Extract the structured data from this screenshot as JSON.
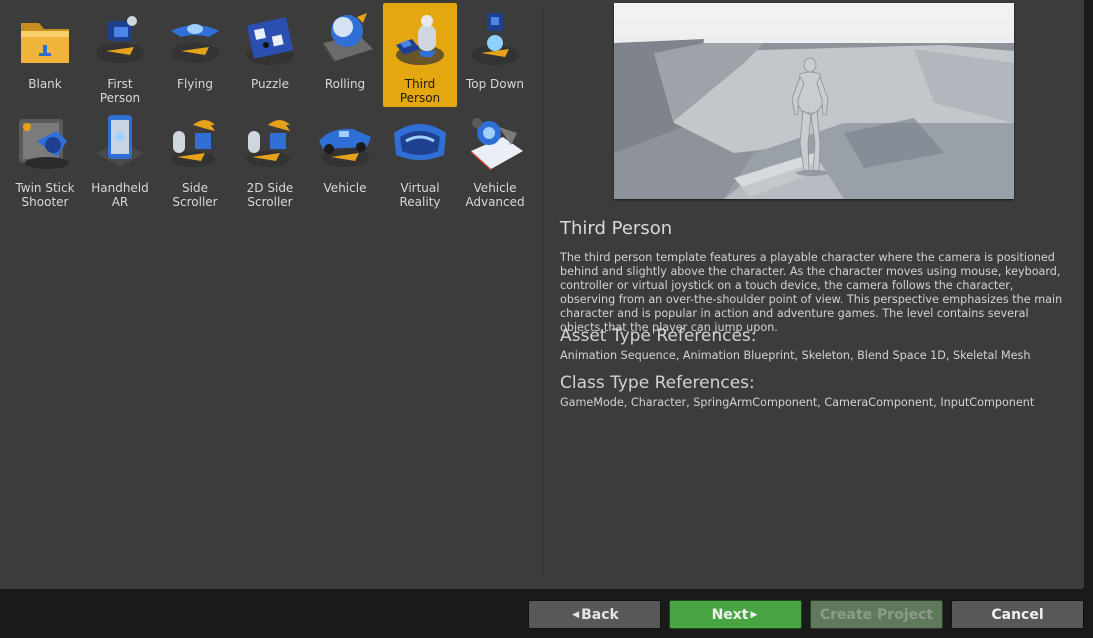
{
  "templates": [
    {
      "line1": "Blank",
      "line2": "",
      "icon": "folder-icon",
      "selected": false
    },
    {
      "line1": "First",
      "line2": "Person",
      "icon": "first-person-icon",
      "selected": false
    },
    {
      "line1": "Flying",
      "line2": "",
      "icon": "flying-icon",
      "selected": false
    },
    {
      "line1": "Puzzle",
      "line2": "",
      "icon": "puzzle-icon",
      "selected": false
    },
    {
      "line1": "Rolling",
      "line2": "",
      "icon": "rolling-icon",
      "selected": false
    },
    {
      "line1": "Third",
      "line2": "Person",
      "icon": "third-person-icon",
      "selected": true
    },
    {
      "line1": "Top Down",
      "line2": "",
      "icon": "top-down-icon",
      "selected": false
    },
    {
      "line1": "Twin Stick",
      "line2": "Shooter",
      "icon": "twin-stick-icon",
      "selected": false
    },
    {
      "line1": "Handheld",
      "line2": "AR",
      "icon": "handheld-ar-icon",
      "selected": false
    },
    {
      "line1": "Side",
      "line2": "Scroller",
      "icon": "side-scroller-icon",
      "selected": false
    },
    {
      "line1": "2D Side",
      "line2": "Scroller",
      "icon": "2d-side-scroller-icon",
      "selected": false
    },
    {
      "line1": "Vehicle",
      "line2": "",
      "icon": "vehicle-icon",
      "selected": false
    },
    {
      "line1": "Virtual",
      "line2": "Reality",
      "icon": "virtual-reality-icon",
      "selected": false
    },
    {
      "line1": "Vehicle",
      "line2": "Advanced",
      "icon": "vehicle-advanced-icon",
      "selected": false
    }
  ],
  "details": {
    "title": "Third Person",
    "description": "The third person template features a playable character where the camera is positioned behind and slightly above the character. As the character moves using mouse, keyboard, controller or virtual joystick on a touch device, the camera follows the character, observing from an over-the-shoulder point of view. This perspective emphasizes the main character and is popular in action and adventure games. The level contains several objects that the player can jump upon.",
    "asset_heading": "Asset Type References:",
    "asset_refs": "Animation Sequence, Animation Blueprint, Skeleton, Blend Space 1D, Skeletal Mesh",
    "class_heading": "Class Type References:",
    "class_refs": "GameMode, Character, SpringArmComponent, CameraComponent, InputComponent"
  },
  "buttons": {
    "back": "Back",
    "next": "Next",
    "create": "Create Project",
    "cancel": "Cancel"
  },
  "colors": {
    "selection": "#e5a70f",
    "next_button": "#49a544",
    "panel": "#3c3c3c"
  }
}
